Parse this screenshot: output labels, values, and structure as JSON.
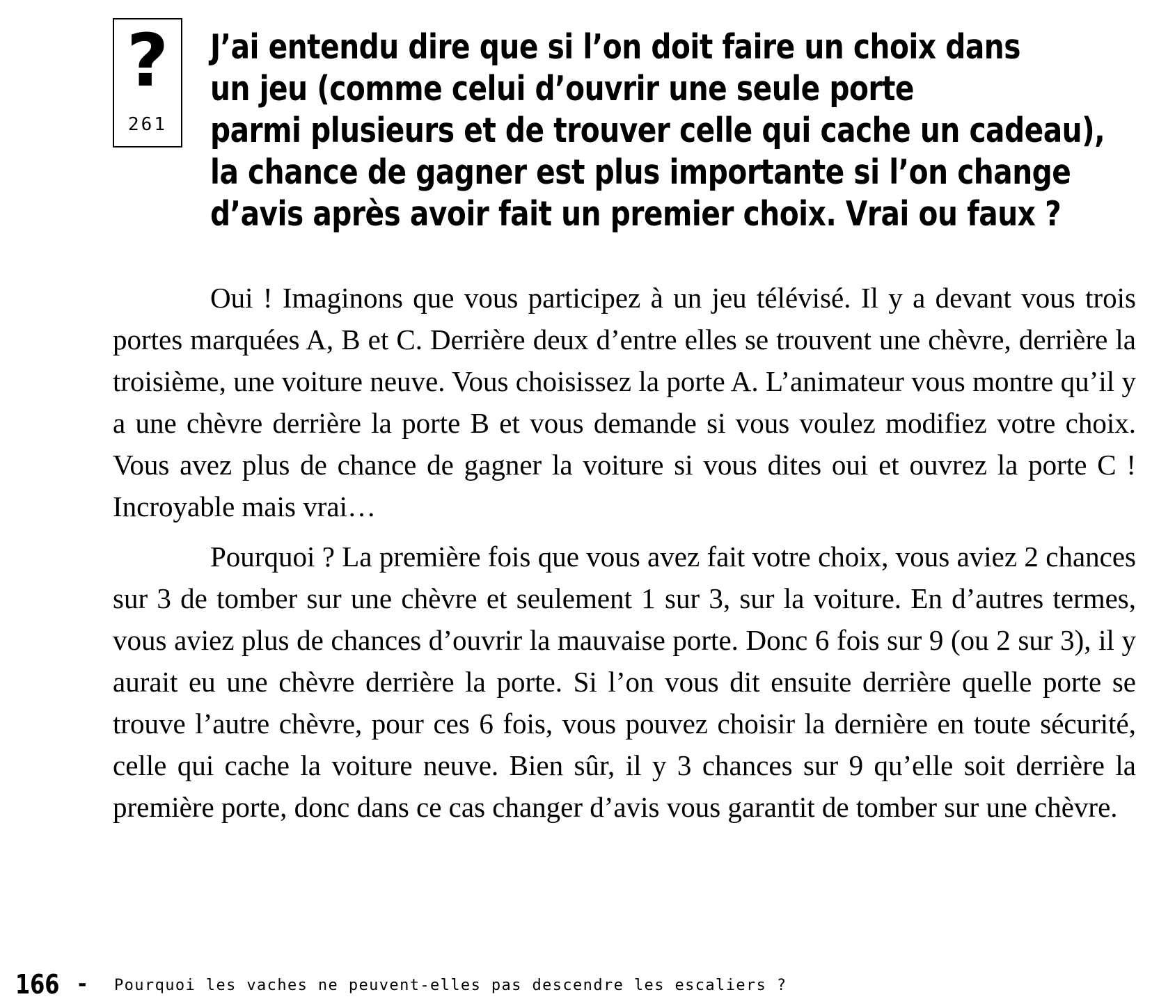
{
  "question_box": {
    "symbol": "?",
    "number": "261"
  },
  "question": {
    "lines": [
      "J’ai entendu dire que si l’on doit faire un choix dans",
      "un jeu (comme celui d’ouvrir une seule porte",
      "parmi plusieurs et de trouver celle qui cache un cadeau),",
      "la chance de gagner est plus importante si l’on change",
      "d’avis après avoir fait un premier choix. Vrai ou faux ?"
    ]
  },
  "answer": {
    "paragraphs": [
      "Oui ! Imaginons que vous participez à un jeu télévisé. Il y a devant vous trois portes marquées A, B et C. Derrière deux d’entre elles se trouvent une chèvre, derrière la troisième, une voiture neuve. Vous choisissez la porte A. L’animateur vous montre qu’il y a une chèvre derrière la porte B et vous demande si vous voulez modifiez votre choix. Vous avez plus de chance de gagner la voiture si vous dites oui et ouvrez la porte C ! Incroyable mais vrai…",
      "Pourquoi ? La première fois que vous avez fait votre choix, vous aviez 2 chances sur 3 de tomber sur une chèvre et seulement 1 sur 3, sur la voiture. En d’autres termes, vous aviez plus de chances d’ouvrir la mauvaise porte. Donc 6 fois sur 9 (ou 2 sur 3), il y aurait eu une chèvre derrière la porte. Si l’on vous dit ensuite derrière quelle porte se trouve l’autre chèvre, pour ces 6 fois, vous pouvez choisir la dernière en toute sécurité, celle qui cache la voiture neuve. Bien sûr, il y 3 chances sur 9 qu’elle soit derrière la première porte, donc dans ce cas changer d’avis vous garantit de tomber sur une chèvre."
    ]
  },
  "footer": {
    "page_number": "166",
    "dash": "-",
    "running_title": "Pourquoi les vaches ne peuvent-elles pas descendre les escaliers ?"
  }
}
